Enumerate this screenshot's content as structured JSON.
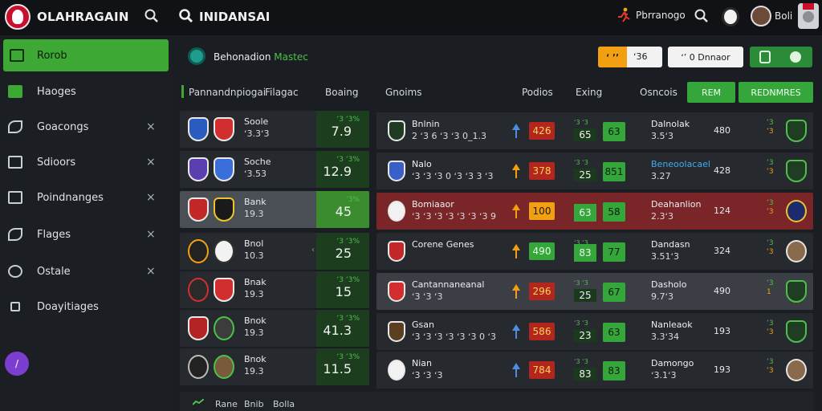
{
  "header": {
    "brand": "OLAHRAGAIN",
    "title": "INIDANSAI",
    "user_label": "Pbrranogo",
    "avatar_label": "Boli"
  },
  "sidebar": {
    "items": [
      {
        "label": "Rorob",
        "active": true,
        "closable": false
      },
      {
        "label": "Haoges",
        "active": false,
        "closable": false
      },
      {
        "label": "Goacongs",
        "active": false,
        "closable": true
      },
      {
        "label": "Sdioors",
        "active": false,
        "closable": true
      },
      {
        "label": "Poindnanges",
        "active": false,
        "closable": true
      },
      {
        "label": "Flages",
        "active": false,
        "closable": true
      },
      {
        "label": "Ostale",
        "active": false,
        "closable": true
      },
      {
        "label": "Doayitiages",
        "active": false,
        "closable": false
      }
    ],
    "close_glyph": "×",
    "fab_glyph": "/"
  },
  "section": {
    "title": "Behonadion",
    "title_accent": "Mastec",
    "filters": [
      {
        "chip": "ʻ ʼʼ",
        "value": "ʻ36"
      },
      {
        "value": "ʻʼ 0 Dnnaor"
      }
    ]
  },
  "columns": {
    "headers": [
      "Pannandnpiogai",
      "Filagac",
      "Boaing",
      "Gnoims",
      "Podios",
      "Exing",
      "Osncois"
    ],
    "buttons": [
      "REM",
      "REDNMRES"
    ]
  },
  "left_rows": [
    {
      "name": "Soole",
      "sub": "ʻ3.3ʻ3",
      "odd_top": "ʻ3 ʻ3%",
      "odd": "7.9",
      "highlight": false
    },
    {
      "name": "Soche",
      "sub": "ʻ3.53",
      "odd_top": "ʻ3 ʻ3%",
      "odd": "12.9",
      "highlight": false
    },
    {
      "name": "Bank",
      "sub": "19.3",
      "odd_top": "ʻ3%",
      "odd": "45",
      "highlight": true
    },
    {
      "name": "Bnol",
      "sub": "10.3",
      "odd_top": "ʻ3 ʻ3%",
      "odd": "25",
      "highlight": false
    },
    {
      "name": "Bnak",
      "sub": "19.3",
      "odd_top": "ʻ3 ʻ3%",
      "odd": "15",
      "highlight": false
    },
    {
      "name": "Bnok",
      "sub": "19.3",
      "odd_top": "ʻ3 ʻ3%",
      "odd": "41.3",
      "highlight": false
    },
    {
      "name": "Bnok",
      "sub": "19.3",
      "odd_top": "ʻ3 ʻ3%",
      "odd": "11.5",
      "highlight": false
    }
  ],
  "right_rows": [
    {
      "name": "Bnlnin",
      "sub": "2 ʻ3 6 ʻ3 ʻ3 0_1.3",
      "odd": "426",
      "odd_style": "red",
      "mini_top": "ʻ3 ʻ3",
      "mini": "65",
      "odd2": "63",
      "mname": "Dalnolak",
      "msub": "3.5ʻ3",
      "mval": "480",
      "ind1": "ʻ3",
      "ind2": "ʻ3",
      "badge": "shield"
    },
    {
      "name": "Nalo",
      "sub": "ʻ3 ʻ3 ʻ3 0 ʻ3 ʻ3 3 ʻ3",
      "odd": "378",
      "odd_style": "red",
      "mini_top": "ʻ3 ʻ3",
      "mini": "25",
      "odd2": "851",
      "mname": "Beneoolacael",
      "msub": "3.27",
      "mval": "428",
      "ind1": "ʻ3",
      "ind2": "ʻ3",
      "badge": "shield",
      "mname_blue": true
    },
    {
      "name": "Bomiaaor",
      "sub": "ʻ3 ʻ3 ʻ3 ʻ3 ʻ3 ʻ3 ʻ3 9",
      "odd": "100",
      "odd_style": "orange",
      "mini_top": "",
      "mini": "63",
      "odd2": "58",
      "mname": "Deahanlion",
      "msub": "2.3ʻ3",
      "mval": "124",
      "ind1": "ʻ3",
      "ind2": "ʻ3",
      "badge": "gold",
      "highlight": true
    },
    {
      "name": "Corene Genes",
      "sub": "",
      "odd": "490",
      "odd_style": "green",
      "mini_top": "ʻ3 ʻ3",
      "mini": "83",
      "odd2": "77",
      "mname": "Dandasn",
      "msub": "3.51ʻ3",
      "mval": "324",
      "ind1": "ʻ3",
      "ind2": "ʻ3",
      "badge": "face"
    },
    {
      "name": "Cantannaneanal",
      "sub": "ʻ3 ʻ3 ʻ3",
      "odd": "296",
      "odd_style": "red",
      "mini_top": "ʻ3 ʻ3",
      "mini": "25",
      "odd2": "67",
      "mname": "Dasholo",
      "msub": "9.7ʻ3",
      "mval": "490",
      "ind1": "ʻ3",
      "ind2": "1",
      "badge": "shield",
      "selected": true
    },
    {
      "name": "Gsan",
      "sub": "ʻ3 ʻ3 ʻ3 ʻ3 ʻ3 ʻ3 0 ʻ3",
      "odd": "586",
      "odd_style": "red",
      "mini_top": "ʻ3 ʻ3",
      "mini": "23",
      "odd2": "63",
      "mname": "Nanleaok",
      "msub": "3.3ʻ34",
      "mval": "193",
      "ind1": "ʻ3",
      "ind2": "ʻ3",
      "badge": "shield"
    },
    {
      "name": "Nian",
      "sub": "ʻ3 ʻ3 ʻ3",
      "odd": "784",
      "odd_style": "red",
      "mini_top": "ʻ3 ʻ3",
      "mini": "83",
      "odd2": "83",
      "mname": "Damongo",
      "msub": "ʻ3.1ʻ3",
      "mval": "193",
      "ind1": "ʻ3",
      "ind2": "ʻ3",
      "badge": "face"
    }
  ],
  "footer": [
    "Rane",
    "Bnib",
    "Bolla"
  ],
  "colors": {
    "accent": "#3ea834",
    "danger": "#b3261e",
    "warn": "#f2a012"
  }
}
